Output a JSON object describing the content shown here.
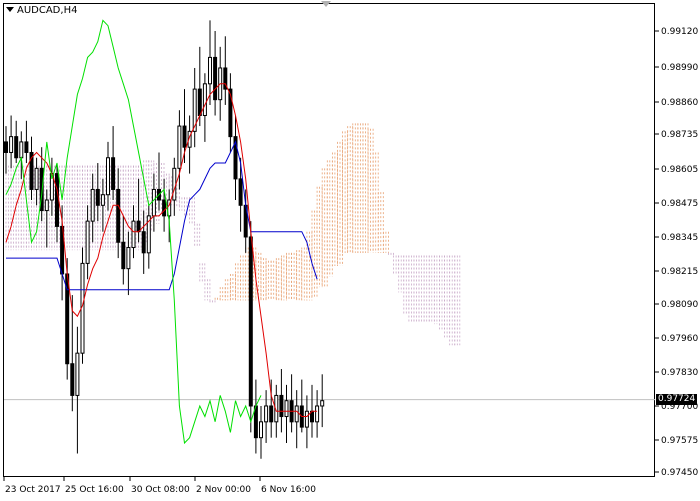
{
  "window": {
    "symbol_label": "AUDCAD,H4"
  },
  "price_axis": {
    "labels": [
      "0.99120",
      "0.98990",
      "0.98860",
      "0.98735",
      "0.98605",
      "0.98475",
      "0.98345",
      "0.98215",
      "0.98090",
      "0.97960",
      "0.97830",
      "0.97700",
      "0.97575",
      "0.97450"
    ],
    "current_price": "0.97724",
    "current_value": 0.97724
  },
  "time_axis": {
    "labels": [
      "23 Oct 2017",
      "25 Oct 16:00",
      "30 Oct 08:00",
      "2 Nov 00:00",
      "6 Nov 16:00"
    ]
  },
  "colors": {
    "candles": "#000000",
    "tenkan": "#e00000",
    "kijun": "#0000cc",
    "chikou": "#00e000",
    "cloud_up": "#e8a070",
    "cloud_down": "#c8a8c8",
    "price_line": "#c0c0c0"
  },
  "chart_data": {
    "type": "candlestick",
    "indicator": "Ichimoku",
    "ylim": [
      0.9742,
      0.992
    ],
    "grid": false,
    "candles": [
      [
        0.987,
        0.9876,
        0.9858,
        0.9866
      ],
      [
        0.9866,
        0.988,
        0.986,
        0.9872
      ],
      [
        0.9872,
        0.9878,
        0.9862,
        0.9864
      ],
      [
        0.9864,
        0.9874,
        0.9856,
        0.987
      ],
      [
        0.987,
        0.9878,
        0.9862,
        0.9866
      ],
      [
        0.9866,
        0.9872,
        0.9848,
        0.9852
      ],
      [
        0.9852,
        0.9864,
        0.9846,
        0.986
      ],
      [
        0.986,
        0.9868,
        0.984,
        0.9844
      ],
      [
        0.9844,
        0.9852,
        0.983,
        0.9848
      ],
      [
        0.9848,
        0.9864,
        0.9842,
        0.9858
      ],
      [
        0.9858,
        0.9862,
        0.9832,
        0.9838
      ],
      [
        0.9838,
        0.9846,
        0.981,
        0.982
      ],
      [
        0.982,
        0.9826,
        0.978,
        0.9786
      ],
      [
        0.9786,
        0.9812,
        0.9768,
        0.9774
      ],
      [
        0.9774,
        0.98,
        0.9752,
        0.979
      ],
      [
        0.979,
        0.983,
        0.9786,
        0.9824
      ],
      [
        0.9824,
        0.9846,
        0.9818,
        0.984
      ],
      [
        0.984,
        0.9858,
        0.9832,
        0.9852
      ],
      [
        0.9852,
        0.9862,
        0.984,
        0.9846
      ],
      [
        0.9846,
        0.9856,
        0.9836,
        0.985
      ],
      [
        0.985,
        0.987,
        0.9844,
        0.9864
      ],
      [
        0.9864,
        0.9876,
        0.9848,
        0.9852
      ],
      [
        0.9852,
        0.986,
        0.9826,
        0.9832
      ],
      [
        0.9832,
        0.9842,
        0.9816,
        0.9822
      ],
      [
        0.9822,
        0.9836,
        0.9812,
        0.983
      ],
      [
        0.983,
        0.9846,
        0.9826,
        0.984
      ],
      [
        0.984,
        0.9856,
        0.9832,
        0.9836
      ],
      [
        0.9836,
        0.9844,
        0.982,
        0.9828
      ],
      [
        0.9828,
        0.9846,
        0.9822,
        0.9842
      ],
      [
        0.9842,
        0.9858,
        0.9836,
        0.9852
      ],
      [
        0.9852,
        0.9866,
        0.9844,
        0.9848
      ],
      [
        0.9848,
        0.9856,
        0.9836,
        0.9842
      ],
      [
        0.9842,
        0.9852,
        0.9832,
        0.9848
      ],
      [
        0.9848,
        0.9864,
        0.9842,
        0.986
      ],
      [
        0.986,
        0.9882,
        0.9852,
        0.9876
      ],
      [
        0.9876,
        0.989,
        0.9862,
        0.9868
      ],
      [
        0.9868,
        0.988,
        0.9858,
        0.9874
      ],
      [
        0.9874,
        0.9898,
        0.9868,
        0.989
      ],
      [
        0.989,
        0.9906,
        0.9876,
        0.988
      ],
      [
        0.988,
        0.9896,
        0.987,
        0.9892
      ],
      [
        0.9892,
        0.9916,
        0.9884,
        0.9902
      ],
      [
        0.9902,
        0.9912,
        0.988,
        0.9886
      ],
      [
        0.9886,
        0.9906,
        0.9878,
        0.9898
      ],
      [
        0.9898,
        0.991,
        0.9884,
        0.989
      ],
      [
        0.989,
        0.9896,
        0.9866,
        0.9872
      ],
      [
        0.9872,
        0.988,
        0.9848,
        0.9856
      ],
      [
        0.9856,
        0.9864,
        0.9836,
        0.9846
      ],
      [
        0.9846,
        0.9852,
        0.9828,
        0.9834
      ],
      [
        0.9834,
        0.984,
        0.976,
        0.977
      ],
      [
        0.977,
        0.978,
        0.9752,
        0.9758
      ],
      [
        0.9758,
        0.977,
        0.975,
        0.9764
      ],
      [
        0.9764,
        0.9776,
        0.9756,
        0.977
      ],
      [
        0.977,
        0.978,
        0.9758,
        0.9764
      ],
      [
        0.9764,
        0.9778,
        0.9758,
        0.9774
      ],
      [
        0.9774,
        0.9784,
        0.976,
        0.9766
      ],
      [
        0.9766,
        0.9778,
        0.9756,
        0.9772
      ],
      [
        0.9772,
        0.9782,
        0.976,
        0.9764
      ],
      [
        0.9764,
        0.9776,
        0.9754,
        0.977
      ],
      [
        0.977,
        0.978,
        0.976,
        0.9762
      ],
      [
        0.9762,
        0.9774,
        0.9754,
        0.9768
      ],
      [
        0.9768,
        0.9778,
        0.9758,
        0.9764
      ],
      [
        0.9764,
        0.9776,
        0.9758,
        0.977
      ],
      [
        0.977,
        0.9782,
        0.9762,
        0.9772
      ]
    ],
    "tenkan": [
      0.9832,
      0.9838,
      0.9846,
      0.9852,
      0.986,
      0.9864,
      0.9866,
      0.9864,
      0.9862,
      0.9858,
      0.9852,
      0.984,
      0.982,
      0.9806,
      0.9804,
      0.9808,
      0.9816,
      0.9822,
      0.9826,
      0.9834,
      0.984,
      0.9846,
      0.9846,
      0.9842,
      0.9838,
      0.9836,
      0.9836,
      0.9838,
      0.984,
      0.9842,
      0.9842,
      0.9844,
      0.9846,
      0.9852,
      0.9858,
      0.9866,
      0.9872,
      0.9876,
      0.988,
      0.9884,
      0.9888,
      0.989,
      0.9892,
      0.9892,
      0.9888,
      0.988,
      0.987,
      0.9856,
      0.9836,
      0.9818,
      0.9804,
      0.979,
      0.9774,
      0.9768,
      0.9768,
      0.9768,
      0.9768,
      0.9768,
      0.9766,
      0.9766,
      0.9768,
      0.9768
    ],
    "kijun": [
      0.9826,
      0.9826,
      0.9826,
      0.9826,
      0.9826,
      0.9826,
      0.9826,
      0.9826,
      0.9826,
      0.9826,
      0.9826,
      0.982,
      0.9814,
      0.9814,
      0.9814,
      0.9814,
      0.9814,
      0.9814,
      0.9814,
      0.9814,
      0.9814,
      0.9814,
      0.9814,
      0.9814,
      0.9814,
      0.9814,
      0.9814,
      0.9814,
      0.9814,
      0.9814,
      0.9814,
      0.9814,
      0.9814,
      0.982,
      0.983,
      0.984,
      0.9848,
      0.985,
      0.9852,
      0.9856,
      0.986,
      0.9862,
      0.9862,
      0.9862,
      0.9866,
      0.987,
      0.9862,
      0.9846,
      0.9836,
      0.9836,
      0.9836,
      0.9836,
      0.9836,
      0.9836,
      0.9836,
      0.9836,
      0.9836,
      0.9836,
      0.9836,
      0.9832,
      0.9824,
      0.9818
    ],
    "chikou": [
      0.985,
      0.9854,
      0.986,
      0.9864,
      0.9848,
      0.9832,
      0.9836,
      0.985,
      0.987,
      0.9856,
      0.9862,
      0.9848,
      0.9864,
      0.9876,
      0.9888,
      0.9894,
      0.9902,
      0.9904,
      0.9908,
      0.9916,
      0.9914,
      0.9906,
      0.9898,
      0.9892,
      0.9886,
      0.9876,
      0.9866,
      0.9856,
      0.9846,
      0.9848,
      0.985,
      0.9852,
      0.984,
      0.981,
      0.977,
      0.9756,
      0.9758,
      0.9764,
      0.977,
      0.9766,
      0.9772,
      0.9764,
      0.9774,
      0.9768,
      0.976,
      0.9772,
      0.9766,
      0.977,
      0.9764,
      0.977,
      0.9774
    ]
  }
}
